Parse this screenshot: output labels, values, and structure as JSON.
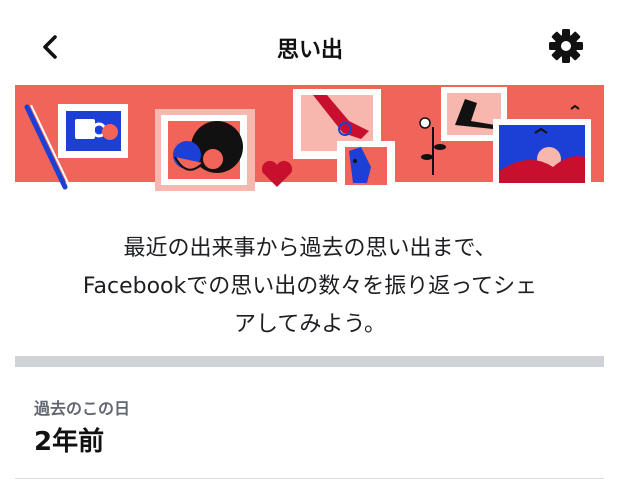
{
  "header": {
    "title": "思い出",
    "back_icon": "chevron-left-icon",
    "settings_icon": "gear-icon"
  },
  "banner": {
    "illustration": "memories-illustration",
    "colors": {
      "background": "#f0645a",
      "accent_blue": "#1c3fd6",
      "dark": "#1c1e21"
    }
  },
  "intro": {
    "line1": "最近の出来事から過去の思い出まで、",
    "line2": "Facebookでの思い出の数々を振り返ってシェ",
    "line3": "アしてみよう。"
  },
  "on_this_day": {
    "label": "過去のこの日",
    "value": "2年前"
  }
}
